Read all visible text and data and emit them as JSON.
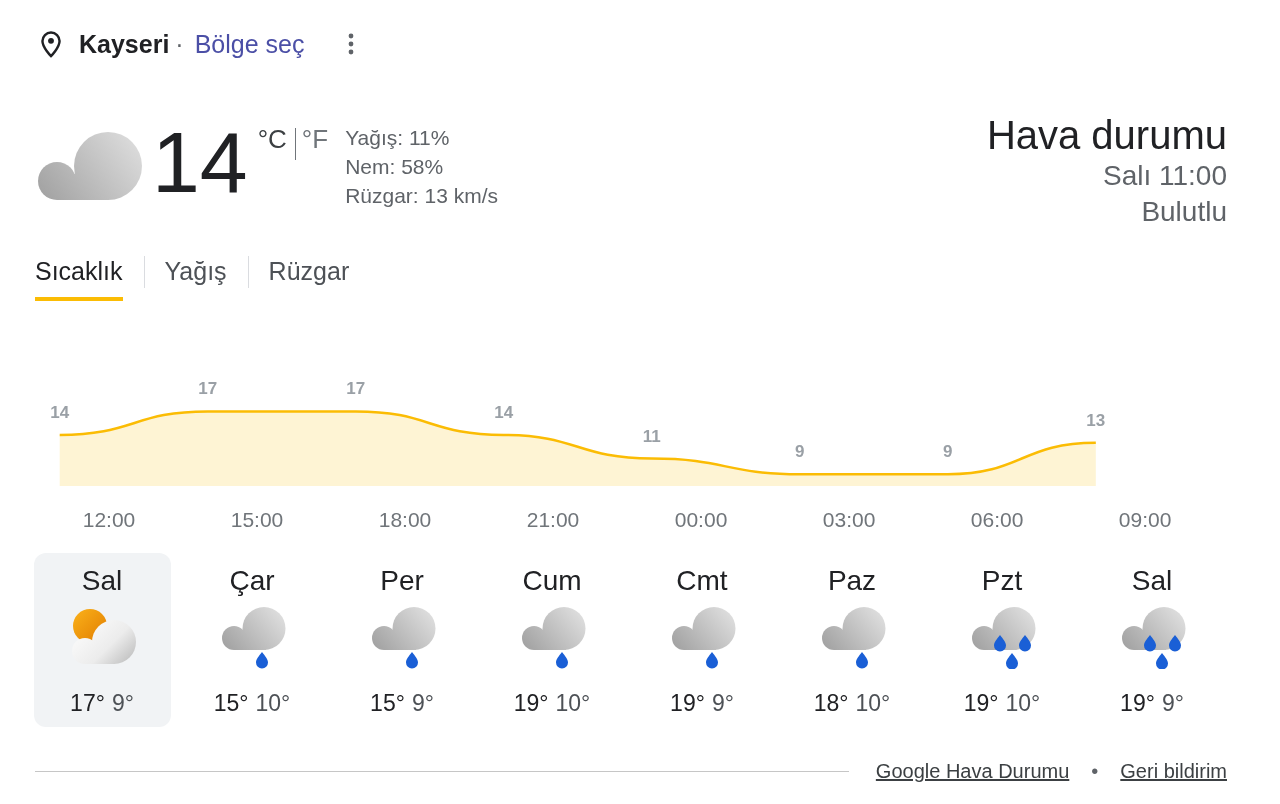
{
  "location": {
    "city": "Kayseri",
    "separator": "·",
    "link": "Bölge seç"
  },
  "current": {
    "temperature": "14",
    "units": [
      {
        "label": "°C",
        "selected": true
      },
      {
        "label": "°F",
        "selected": false
      }
    ],
    "details": [
      "Yağış: 11%",
      "Nem: 58%",
      "Rüzgar: 13 km/s"
    ]
  },
  "summary": {
    "title": "Hava durumu",
    "time": "Salı 11:00",
    "condition": "Bulutlu"
  },
  "tabs": [
    {
      "label": "Sıcaklık",
      "selected": true
    },
    {
      "label": "Yağış",
      "selected": false
    },
    {
      "label": "Rüzgar",
      "selected": false
    }
  ],
  "chart": {
    "chart_data": {
      "type": "area",
      "categories": [
        null,
        "12:00",
        null,
        null,
        "15:00",
        null,
        null,
        "18:00",
        null,
        null,
        "21:00",
        null,
        null,
        "00:00",
        null,
        null,
        "03:00",
        null,
        null,
        "06:00",
        null,
        null,
        "09:00",
        null
      ],
      "series": [
        {
          "color": "#fbbc04",
          "values": [
            14,
            null,
            null,
            17,
            null,
            null,
            17,
            null,
            null,
            14,
            null,
            null,
            11,
            null,
            null,
            9,
            null,
            null,
            9,
            null,
            null,
            13,
            null,
            null
          ]
        }
      ],
      "data_labels": true
    }
  },
  "days": [
    {
      "day": "Sal",
      "kind": "partlycloudy",
      "high": "17°",
      "low": "9°",
      "selected": true
    },
    {
      "day": "Çar",
      "kind": "lightrain",
      "high": "15°",
      "low": "10°",
      "selected": false
    },
    {
      "day": "Per",
      "kind": "lightrain",
      "high": "15°",
      "low": "9°",
      "selected": false
    },
    {
      "day": "Cum",
      "kind": "lightrain",
      "high": "19°",
      "low": "10°",
      "selected": false
    },
    {
      "day": "Cmt",
      "kind": "lightrain",
      "high": "19°",
      "low": "9°",
      "selected": false
    },
    {
      "day": "Paz",
      "kind": "lightrain",
      "high": "18°",
      "low": "10°",
      "selected": false
    },
    {
      "day": "Pzt",
      "kind": "rain",
      "high": "19°",
      "low": "10°",
      "selected": false
    },
    {
      "day": "Sal",
      "kind": "rain",
      "high": "19°",
      "low": "9°",
      "selected": false
    }
  ],
  "footer": {
    "links": [
      "Google Hava Durumu",
      "Geri bildirim"
    ],
    "separator": "•"
  }
}
